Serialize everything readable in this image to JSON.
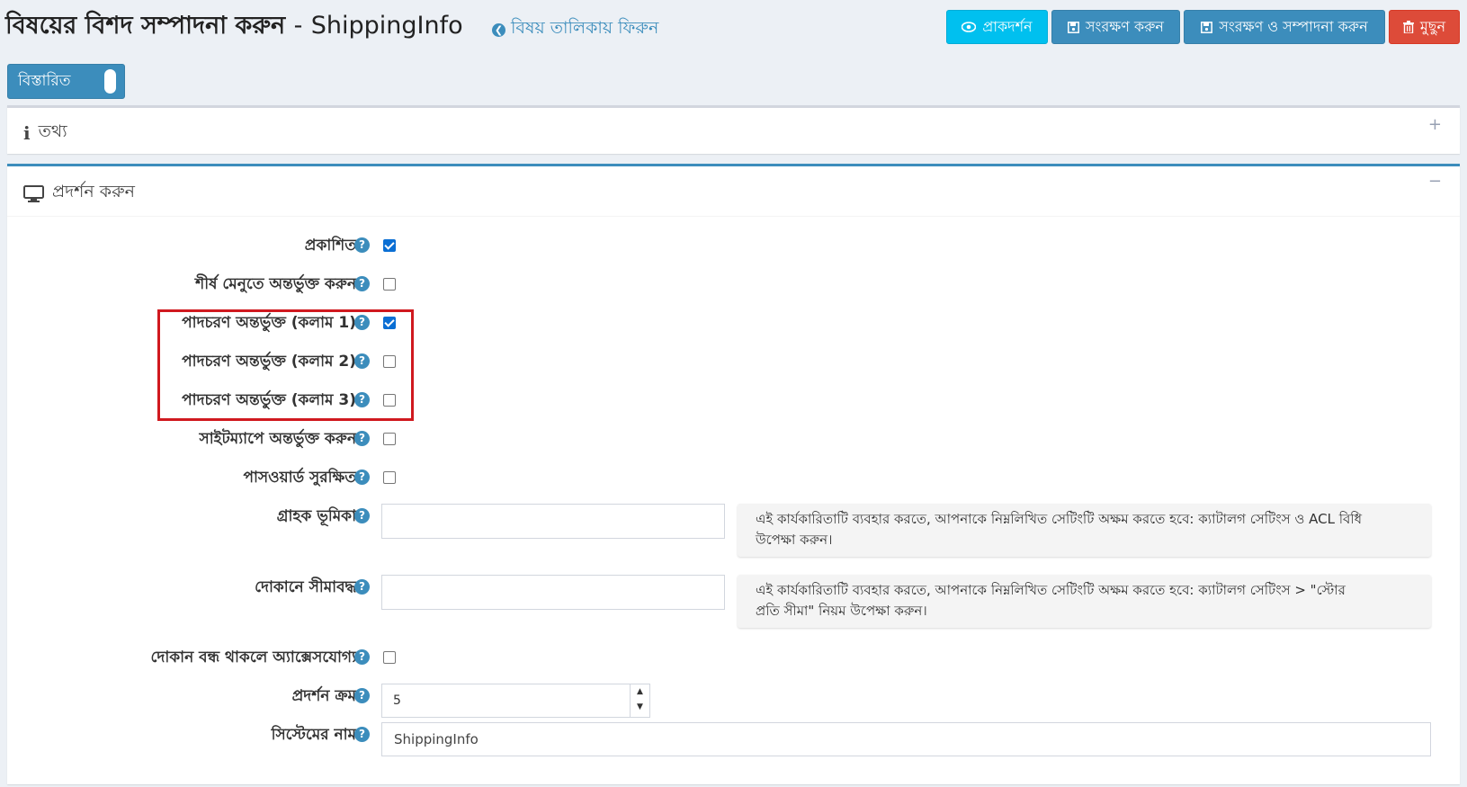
{
  "header": {
    "title_prefix": "বিষয়ের বিশদ সম্পাদনা করুন",
    "title_sep": "-",
    "title_name": "ShippingInfo",
    "back_link": "বিষয় তালিকায় ফিরুন",
    "buttons": {
      "preview": "প্রাকদর্শন",
      "save": "সংরক্ষণ করুন",
      "save_edit": "সংরক্ষণ ও সম্পাদনা করুন",
      "delete": "মুছুন"
    }
  },
  "toggle": {
    "label": "বিস্তারিত",
    "state": "on"
  },
  "info_box": {
    "title": "তথ্য",
    "collapsed": true
  },
  "display_box": {
    "title": "প্রদর্শন করুন",
    "fields": {
      "published": {
        "label": "প্রকাশিত",
        "checked": true
      },
      "include_top_menu": {
        "label": "শীর্ষ মেনুতে অন্তর্ভুক্ত করুন",
        "checked": false
      },
      "footer_col1": {
        "label": "পাদচরণ অন্তর্ভুক্ত (কলাম 1)",
        "checked": true
      },
      "footer_col2": {
        "label": "পাদচরণ অন্তর্ভুক্ত (কলাম 2)",
        "checked": false
      },
      "footer_col3": {
        "label": "পাদচরণ অন্তর্ভুক্ত (কলাম 3)",
        "checked": false
      },
      "include_sitemap": {
        "label": "সাইটম্যাপে অন্তর্ভুক্ত করুন",
        "checked": false
      },
      "password_protected": {
        "label": "পাসওয়ার্ড সুরক্ষিত",
        "checked": false
      },
      "customer_roles": {
        "label": "গ্রাহক ভূমিকা",
        "value": "",
        "note_line1": "এই কার্যকারিতাটি ব্যবহার করতে, আপনাকে নিম্নলিখিত সেটিংটি অক্ষম করতে হবে: ক্যাটালগ সেটিংস ও ACL বিধি",
        "note_line2": "উপেক্ষা করুন।"
      },
      "limited_to_stores": {
        "label": "দোকানে সীমাবদ্ধ",
        "value": "",
        "note_line1": "এই কার্যকারিতাটি ব্যবহার করতে, আপনাকে নিম্নলিখিত সেটিংটি অক্ষম করতে হবে: ক্যাটালগ সেটিংস > \"স্টোর",
        "note_line2": "প্রতি সীমা\" নিয়ম উপেক্ষা করুন।"
      },
      "accessible_when_closed": {
        "label": "দোকান বন্ধ থাকলে অ্যাক্সেসযোগ্য",
        "checked": false
      },
      "display_order": {
        "label": "প্রদর্শন ক্রম",
        "value": "5"
      },
      "system_name": {
        "label": "সিস্টেমের নাম",
        "value": "ShippingInfo"
      }
    }
  },
  "colors": {
    "primary": "#3c8dbc",
    "info": "#00c0ef",
    "danger": "#dd4b39",
    "highlight": "#d0191f"
  }
}
